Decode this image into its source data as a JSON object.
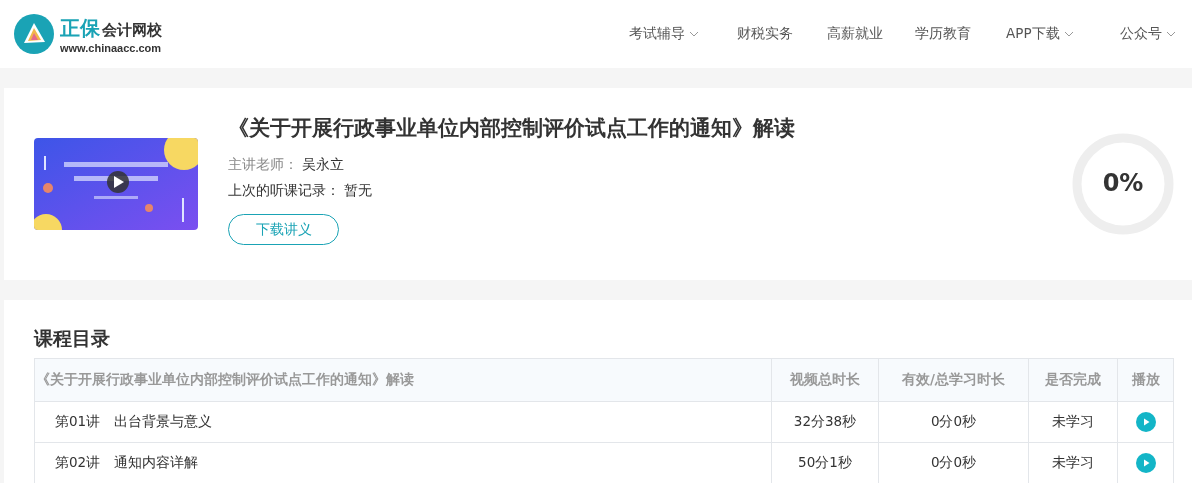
{
  "header": {
    "logo": {
      "brand": "正保",
      "name": "会计网校",
      "url": "www.chinaacc.com"
    },
    "nav": [
      {
        "label": "考试辅导",
        "dropdown": true
      },
      {
        "label": "财税实务",
        "dropdown": false
      },
      {
        "label": "高薪就业",
        "dropdown": false
      },
      {
        "label": "学历教育",
        "dropdown": false
      },
      {
        "label": "APP下载",
        "dropdown": true
      },
      {
        "label": "公众号",
        "dropdown": true
      }
    ]
  },
  "course": {
    "title": "《关于开展行政事业单位内部控制评价试点工作的通知》解读",
    "teacher_label": "主讲老师：",
    "teacher": "吴永立",
    "record_label": "上次的听课记录：",
    "record": "暂无",
    "download_button": "下载讲义",
    "progress": {
      "reading": "0%"
    }
  },
  "catalog": {
    "title": "课程目录",
    "columns": [
      "《关于开展行政事业单位内部控制评价试点工作的通知》解读",
      "视频总时长",
      "有效/总学习时长",
      "是否完成",
      "播放"
    ],
    "rows": [
      {
        "lecture": "第01讲",
        "name": "出台背景与意义",
        "duration": "32分38秒",
        "studied": "0分0秒",
        "status": "未学习"
      },
      {
        "lecture": "第02讲",
        "name": "通知内容详解",
        "duration": "50分1秒",
        "studied": "0分0秒",
        "status": "未学习"
      }
    ]
  }
}
